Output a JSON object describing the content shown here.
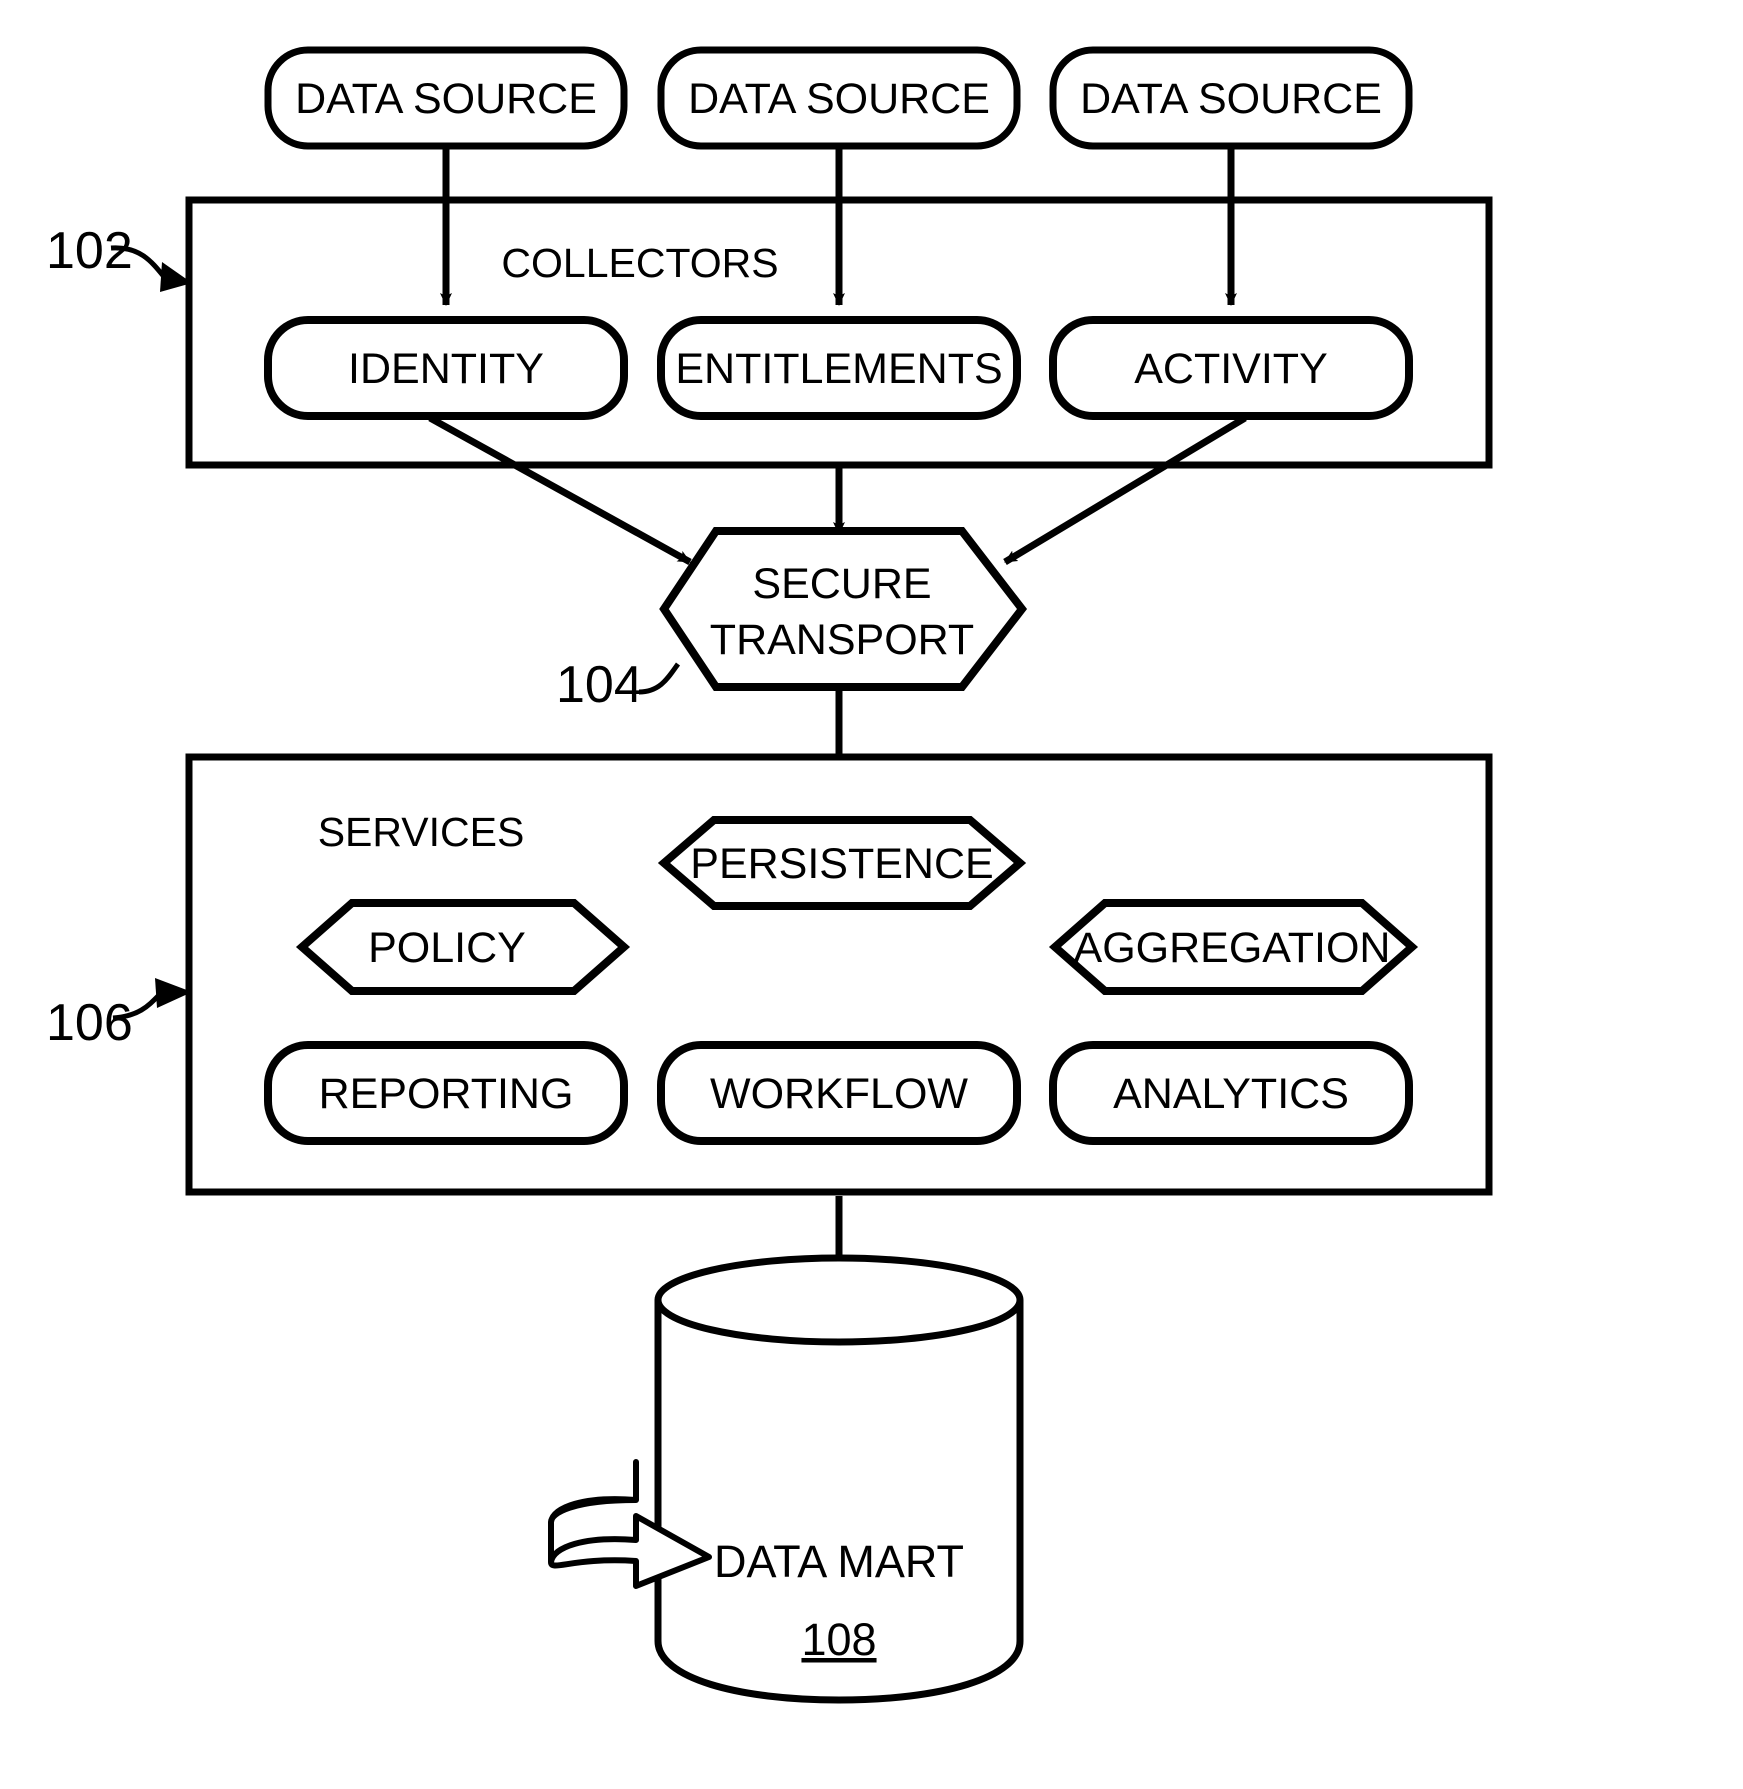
{
  "figure": {
    "type": "patent-block-diagram",
    "background_color": "#ffffff",
    "line_color": "#000000"
  },
  "data_sources": [
    {
      "label": "DATA SOURCE"
    },
    {
      "label": "DATA SOURCE"
    },
    {
      "label": "DATA SOURCE"
    }
  ],
  "collectors": {
    "ref": "102",
    "title": "COLLECTORS",
    "items": [
      {
        "label": "IDENTITY"
      },
      {
        "label": "ENTITLEMENTS"
      },
      {
        "label": "ACTIVITY"
      }
    ]
  },
  "transport": {
    "ref": "104",
    "label_line1": "SECURE",
    "label_line2": "TRANSPORT"
  },
  "services": {
    "ref": "106",
    "title": "SERVICES",
    "hexagons": [
      {
        "label": "PERSISTENCE"
      },
      {
        "label": "POLICY"
      },
      {
        "label": "AGGREGATION"
      }
    ],
    "boxes": [
      {
        "label": "REPORTING"
      },
      {
        "label": "WORKFLOW"
      },
      {
        "label": "ANALYTICS"
      }
    ]
  },
  "data_mart": {
    "ref": "108",
    "label": "DATA MART"
  }
}
